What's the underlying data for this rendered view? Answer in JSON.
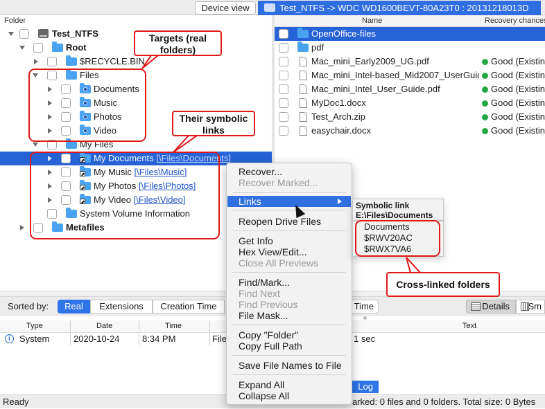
{
  "toolbar": {
    "device_view": "Device view",
    "window_title": "Test_NTFS -> WDC WD1600BEVT-80A23T0 : 20131218013D"
  },
  "tree": {
    "header": "Folder",
    "rows": [
      {
        "label": "Test_NTFS",
        "bold": true
      },
      {
        "label": "Root",
        "bold": true
      },
      {
        "label": "$RECYCLE.BIN"
      },
      {
        "label": "Files"
      },
      {
        "label": "Documents"
      },
      {
        "label": "Music"
      },
      {
        "label": "Photos"
      },
      {
        "label": "Video"
      },
      {
        "label": "My Files"
      },
      {
        "label": "My Documents",
        "link": "[\\Files\\Documents]"
      },
      {
        "label": "My Music",
        "link": "[\\Files\\Music]"
      },
      {
        "label": "My Photos",
        "link": "[\\Files\\Photos]"
      },
      {
        "label": "My Video",
        "link": "[\\Files\\Video]"
      },
      {
        "label": "System Volume Information"
      },
      {
        "label": "Metafiles",
        "bold": true
      }
    ]
  },
  "files": {
    "col_name": "Name",
    "col_recovery": "Recovery chances",
    "rows": [
      {
        "name": "OpenOffice-files",
        "status": ""
      },
      {
        "name": "pdf",
        "status": ""
      },
      {
        "name": "Mac_mini_Early2009_UG.pdf",
        "status": "Good (Existin"
      },
      {
        "name": "Mac_mini_Intel-based_Mid2007_UserGuid",
        "status": "Good (Existin"
      },
      {
        "name": "Mac_mini_Intel_User_Guide.pdf",
        "status": "Good (Existin"
      },
      {
        "name": "MyDoc1.docx",
        "status": "Good (Existin"
      },
      {
        "name": "Test_Arch.zip",
        "status": "Good (Existin"
      },
      {
        "name": "easychair.docx",
        "status": "Good (Existin"
      }
    ]
  },
  "context_menu": {
    "items": [
      "Recover...",
      "Recover Marked...",
      "Links",
      "Reopen Drive Files",
      "Get Info",
      "Hex View/Edit...",
      "Close All Previews",
      "Find/Mark...",
      "Find Next",
      "Find Previous",
      "File Mask...",
      "Copy \"Folder\"",
      "Copy Full Path",
      "Save File Names to File",
      "Expand All",
      "Collapse All"
    ]
  },
  "submenu": {
    "title": "Symbolic link",
    "path": "E:\\Files\\Documents",
    "crosslinked": [
      "Documents",
      "$RWV20AC",
      "$RWX7VA6"
    ]
  },
  "callouts": {
    "targets": "Targets (real folders)",
    "symlinks": "Their symbolic links",
    "crosslinked": "Cross-linked folders"
  },
  "sortbar": {
    "label": "Sorted by:",
    "tabs": [
      "Real",
      "Extensions",
      "Creation Time"
    ],
    "partial_tab": "Time",
    "details": "Details",
    "small": "Sm"
  },
  "log": {
    "headers": [
      "Type",
      "Date",
      "Time",
      "Text"
    ],
    "row": {
      "type": "System",
      "date": "2020-10-24",
      "time": "8:34 PM",
      "text_a": "File",
      "text_b": "1 sec"
    },
    "tab": "Log"
  },
  "statusbar": {
    "left": "Ready",
    "right": "arked: 0 files and 0 folders. Total size: 0 Bytes"
  },
  "colors": {
    "accent": "#2563d6",
    "callout": "#e01818",
    "good": "#22a844"
  }
}
